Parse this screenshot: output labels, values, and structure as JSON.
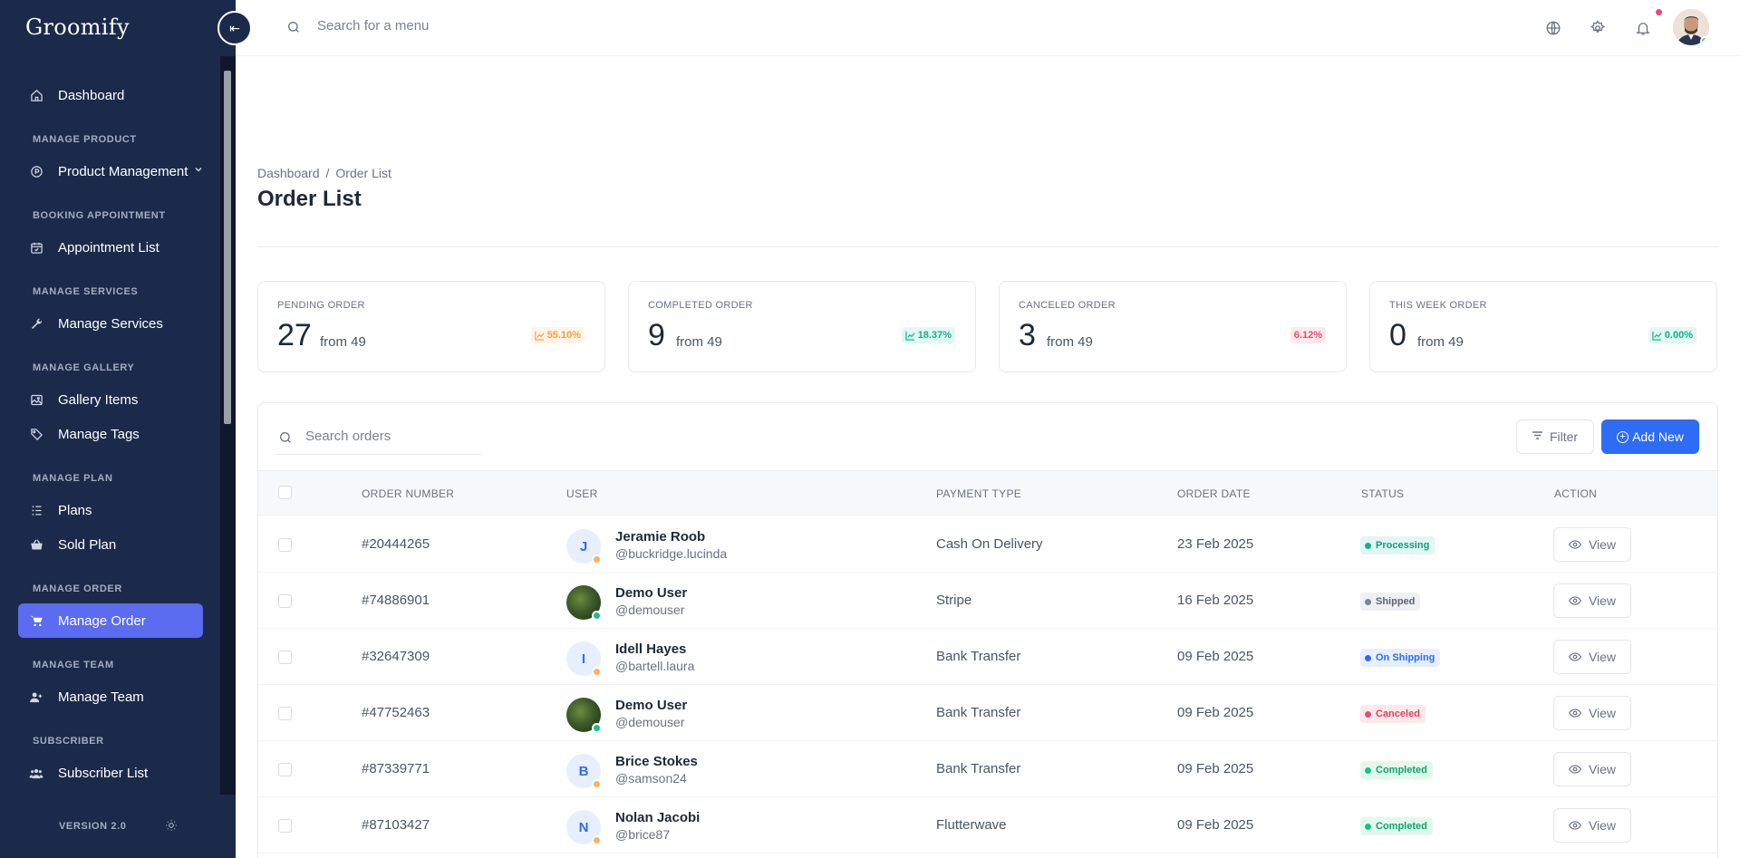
{
  "app": {
    "logo": "Groomify"
  },
  "topbar": {
    "search_placeholder": "Search for a menu"
  },
  "sidebar": {
    "items": [
      {
        "type": "item",
        "label": "Dashboard",
        "icon": "home-icon",
        "name": "sidebar-item-dashboard"
      },
      {
        "type": "section",
        "label": "MANAGE PRODUCT"
      },
      {
        "type": "item",
        "label": "Product Management",
        "icon": "product-icon",
        "name": "sidebar-item-product-management",
        "chevron": true
      },
      {
        "type": "section",
        "label": "BOOKING APPOINTMENT"
      },
      {
        "type": "item",
        "label": "Appointment List",
        "icon": "calendar-icon",
        "name": "sidebar-item-appointment-list"
      },
      {
        "type": "section",
        "label": "MANAGE SERVICES"
      },
      {
        "type": "item",
        "label": "Manage Services",
        "icon": "wrench-icon",
        "name": "sidebar-item-manage-services"
      },
      {
        "type": "section",
        "label": "MANAGE GALLERY"
      },
      {
        "type": "item",
        "label": "Gallery Items",
        "icon": "image-icon",
        "name": "sidebar-item-gallery-items"
      },
      {
        "type": "item",
        "label": "Manage Tags",
        "icon": "tag-icon",
        "name": "sidebar-item-manage-tags"
      },
      {
        "type": "section",
        "label": "MANAGE PLAN"
      },
      {
        "type": "item",
        "label": "Plans",
        "icon": "list-icon",
        "name": "sidebar-item-plans"
      },
      {
        "type": "item",
        "label": "Sold Plan",
        "icon": "basket-icon",
        "name": "sidebar-item-sold-plan"
      },
      {
        "type": "section",
        "label": "MANAGE ORDER"
      },
      {
        "type": "item",
        "label": "Manage Order",
        "icon": "cart-icon",
        "name": "sidebar-item-manage-order",
        "active": true
      },
      {
        "type": "section",
        "label": "MANAGE TEAM"
      },
      {
        "type": "item",
        "label": "Manage Team",
        "icon": "user-plus-icon",
        "name": "sidebar-item-manage-team"
      },
      {
        "type": "section",
        "label": "SUBSCRIBER"
      },
      {
        "type": "item",
        "label": "Subscriber List",
        "icon": "users-icon",
        "name": "sidebar-item-subscriber-list"
      }
    ],
    "version": "VERSION 2.0"
  },
  "header": {
    "breadcrumb": [
      "Dashboard",
      "Order List"
    ],
    "breadcrumb_sep": "/",
    "title": "Order List"
  },
  "stats": [
    {
      "label": "PENDING ORDER",
      "value": "27",
      "from": "from 49",
      "badge": "55.10%",
      "tone": "orange"
    },
    {
      "label": "COMPLETED ORDER",
      "value": "9",
      "from": "from 49",
      "badge": "18.37%",
      "tone": "teal"
    },
    {
      "label": "CANCELED ORDER",
      "value": "3",
      "from": "from 49",
      "badge": "6.12%",
      "tone": "red"
    },
    {
      "label": "THIS WEEK ORDER",
      "value": "0",
      "from": "from 49",
      "badge": "0.00%",
      "tone": "teal"
    }
  ],
  "table": {
    "search_placeholder": "Search orders",
    "filter_label": "Filter",
    "add_label": "Add New",
    "columns": [
      "ORDER NUMBER",
      "USER",
      "PAYMENT TYPE",
      "ORDER DATE",
      "STATUS",
      "ACTION"
    ],
    "view_label": "View",
    "rows": [
      {
        "order": "#20444265",
        "initial": "J",
        "avatar": "initial",
        "dot": "warn",
        "name": "Jeramie Roob",
        "handle": "@buckridge.lucinda",
        "payment": "Cash On Delivery",
        "date": "23 Feb 2025",
        "status": "Processing",
        "status_key": "processing"
      },
      {
        "order": "#74886901",
        "initial": "",
        "avatar": "photo",
        "dot": "ok",
        "name": "Demo User",
        "handle": "@demouser",
        "payment": "Stripe",
        "date": "16 Feb 2025",
        "status": "Shipped",
        "status_key": "shipped"
      },
      {
        "order": "#32647309",
        "initial": "I",
        "avatar": "initial",
        "dot": "warn",
        "name": "Idell Hayes",
        "handle": "@bartell.laura",
        "payment": "Bank Transfer",
        "date": "09 Feb 2025",
        "status": "On Shipping",
        "status_key": "onshipping"
      },
      {
        "order": "#47752463",
        "initial": "",
        "avatar": "photo",
        "dot": "ok",
        "name": "Demo User",
        "handle": "@demouser",
        "payment": "Bank Transfer",
        "date": "09 Feb 2025",
        "status": "Canceled",
        "status_key": "canceled"
      },
      {
        "order": "#87339771",
        "initial": "B",
        "avatar": "initial",
        "dot": "warn",
        "name": "Brice Stokes",
        "handle": "@samson24",
        "payment": "Bank Transfer",
        "date": "09 Feb 2025",
        "status": "Completed",
        "status_key": "completed"
      },
      {
        "order": "#87103427",
        "initial": "N",
        "avatar": "initial",
        "dot": "warn",
        "name": "Nolan Jacobi",
        "handle": "@brice87",
        "payment": "Flutterwave",
        "date": "09 Feb 2025",
        "status": "Completed",
        "status_key": "completed"
      }
    ]
  },
  "colors": {
    "sidebar_bg": "#1b2a4a",
    "active": "#5b6cf0",
    "primary": "#2f6cf5"
  }
}
